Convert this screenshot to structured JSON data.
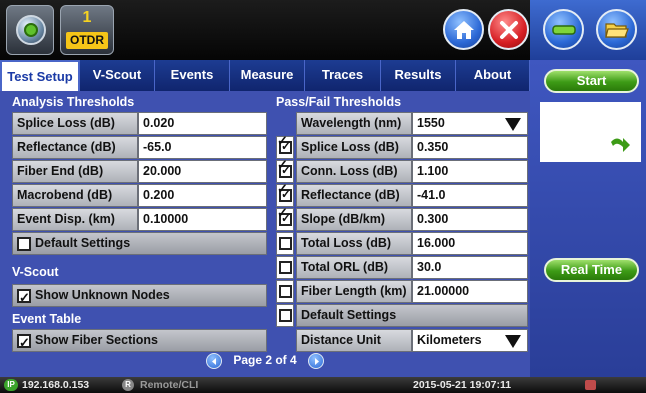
{
  "header": {
    "instrument_count": "1",
    "instrument_label": "OTDR"
  },
  "tabs": [
    "Test Setup",
    "V-Scout",
    "Events",
    "Measure",
    "Traces",
    "Results",
    "About"
  ],
  "analysis": {
    "title": "Analysis Thresholds",
    "rows": [
      {
        "label": "Splice Loss (dB)",
        "value": "0.020"
      },
      {
        "label": "Reflectance (dB)",
        "value": "-65.0"
      },
      {
        "label": "Fiber End (dB)",
        "value": "20.000"
      },
      {
        "label": "Macrobend (dB)",
        "value": "0.200"
      },
      {
        "label": "Event Disp. (km)",
        "value": "0.10000"
      }
    ],
    "default_settings": "Default Settings"
  },
  "vscout": {
    "title": "V-Scout",
    "show_unknown_nodes": "Show Unknown Nodes"
  },
  "event_table": {
    "title": "Event Table",
    "show_fiber_sections": "Show Fiber Sections"
  },
  "passfail": {
    "title": "Pass/Fail Thresholds",
    "wavelength_label": "Wavelength (nm)",
    "wavelength_value": "1550",
    "rows": [
      {
        "label": "Splice Loss (dB)",
        "value": "0.350",
        "checked": true
      },
      {
        "label": "Conn. Loss (dB)",
        "value": "1.100",
        "checked": true
      },
      {
        "label": "Reflectance (dB)",
        "value": "-41.0",
        "checked": true
      },
      {
        "label": "Slope (dB/km)",
        "value": "0.300",
        "checked": true
      },
      {
        "label": "Total Loss (dB)",
        "value": "16.000",
        "checked": false
      },
      {
        "label": "Total ORL (dB)",
        "value": "30.0",
        "checked": false
      },
      {
        "label": "Fiber Length (km)",
        "value": "21.00000",
        "checked": false
      }
    ],
    "default_settings": "Default Settings"
  },
  "distance": {
    "label": "Distance Unit",
    "value": "Kilometers"
  },
  "pager": {
    "text": "Page 2 of 4"
  },
  "side": {
    "start": "Start",
    "realtime": "Real Time"
  },
  "status": {
    "ip": "192.168.0.153",
    "remote": "Remote/CLI",
    "datetime": "2015-05-21 19:07:11"
  },
  "colors": {
    "panel": "#3f51b0",
    "tab_active_text": "#1a3aa6",
    "green_button": "#3d9b16",
    "home_blue": "#2c69d6",
    "close_red": "#d61f24"
  }
}
